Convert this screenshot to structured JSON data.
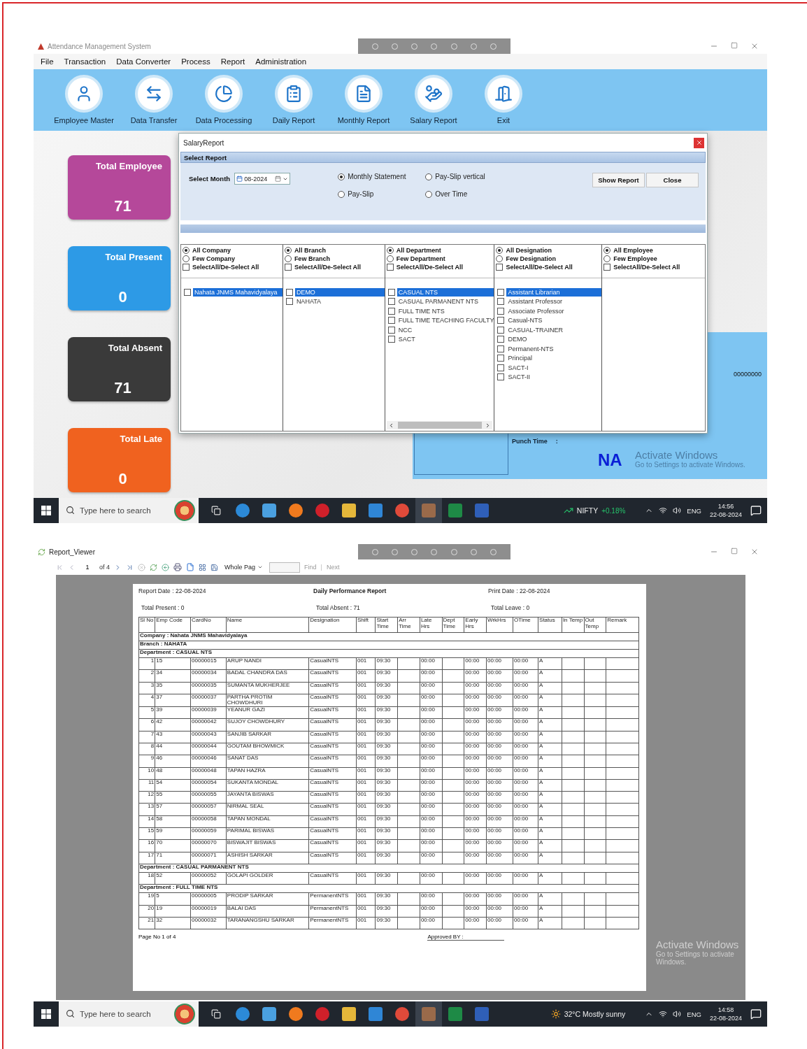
{
  "app_window": {
    "title": "Attendance Management System",
    "menu": [
      "File",
      "Transaction",
      "Data Converter",
      "Process",
      "Report",
      "Administration"
    ],
    "toolbar": [
      "Employee Master",
      "Data Transfer",
      "Data Processing",
      "Daily Report",
      "Monthly Report",
      "Salary Report",
      "Exit"
    ],
    "stat_cards": [
      {
        "label": "Total Employee",
        "value": "71",
        "color": "#b5489a"
      },
      {
        "label": "Total Present",
        "value": "0",
        "color": "#2d9ae6"
      },
      {
        "label": "Total Absent",
        "value": "71",
        "color": "#3a3a3a"
      },
      {
        "label": "Total Late",
        "value": "0",
        "color": "#f0621f"
      }
    ],
    "info_panel": {
      "card_no": "00000000",
      "punch_label": "Punch Time",
      "punch_separator": ":",
      "punch_value": "NA"
    },
    "activation_notice": {
      "title": "Activate Windows",
      "hint": "Go to Settings to activate Windows."
    },
    "dialog": {
      "title": "SalaryReport",
      "section_title": "Select Report",
      "month_label": "Select Month",
      "month_value": "08-2024",
      "report_types": [
        {
          "label": "Monthly Statement",
          "selected": true
        },
        {
          "label": "Pay-Slip vertical",
          "selected": false
        },
        {
          "label": "Pay-Slip",
          "selected": false
        },
        {
          "label": "Over Time",
          "selected": false
        }
      ],
      "buttons": [
        "Show Report",
        "Close"
      ],
      "filters": [
        {
          "options": [
            {
              "label": "All Company",
              "selected": true
            },
            {
              "label": "Few Company",
              "selected": false
            }
          ],
          "select_all": {
            "label": "SelectAll/De-Select All",
            "checked": false
          },
          "items": [
            {
              "label": "Nahata JNMS Mahavidyalaya",
              "checked": false,
              "selected": true
            }
          ]
        },
        {
          "options": [
            {
              "label": "All Branch",
              "selected": true
            },
            {
              "label": "Few Branch",
              "selected": false
            }
          ],
          "select_all": {
            "label": "SelectAll/De-Select All",
            "checked": false
          },
          "items": [
            {
              "label": "DEMO",
              "checked": false,
              "selected": true
            },
            {
              "label": "NAHATA",
              "checked": false,
              "selected": false
            }
          ]
        },
        {
          "options": [
            {
              "label": "All Department",
              "selected": true
            },
            {
              "label": "Few Department",
              "selected": false
            }
          ],
          "select_all": {
            "label": "SelectAll/De-Select All",
            "checked": false
          },
          "horizontal_scrollbar": true,
          "items": [
            {
              "label": "CASUAL NTS",
              "checked": false,
              "selected": true
            },
            {
              "label": "CASUAL PARMANENT NTS",
              "checked": false,
              "selected": false
            },
            {
              "label": "FULL TIME NTS",
              "checked": false,
              "selected": false
            },
            {
              "label": "FULL TIME TEACHING FACULTY",
              "checked": false,
              "selected": false
            },
            {
              "label": "NCC",
              "checked": false,
              "selected": false
            },
            {
              "label": "SACT",
              "checked": false,
              "selected": false
            }
          ]
        },
        {
          "options": [
            {
              "label": "All Designation",
              "selected": true
            },
            {
              "label": "Few Designation",
              "selected": false
            }
          ],
          "select_all": {
            "label": "SelectAll/De-Select All",
            "checked": false
          },
          "items": [
            {
              "label": "Assistant Librarian",
              "checked": false,
              "selected": true
            },
            {
              "label": "Assistant Professor",
              "checked": false,
              "selected": false
            },
            {
              "label": "Associate Professor",
              "checked": false,
              "selected": false
            },
            {
              "label": "Casual-NTS",
              "checked": false,
              "selected": false
            },
            {
              "label": "CASUAL-TRAINER",
              "checked": false,
              "selected": false
            },
            {
              "label": "DEMO",
              "checked": false,
              "selected": false
            },
            {
              "label": "Permanent-NTS",
              "checked": false,
              "selected": false
            },
            {
              "label": "Principal",
              "checked": false,
              "selected": false
            },
            {
              "label": "SACT-I",
              "checked": false,
              "selected": false
            },
            {
              "label": "SACT-II",
              "checked": false,
              "selected": false
            }
          ]
        },
        {
          "options": [
            {
              "label": "All Employee",
              "selected": true
            },
            {
              "label": "Few Employee",
              "selected": false
            }
          ],
          "select_all": {
            "label": "SelectAll/De-Select All",
            "checked": false
          }
        }
      ]
    },
    "taskbar": {
      "search_placeholder": "Type here to search",
      "widget": {
        "kind": "stock",
        "label": "NIFTY",
        "change": "+0.18%"
      },
      "language": "ENG",
      "time": "14:56",
      "date": "22-08-2024"
    }
  },
  "report_window": {
    "title": "Report_Viewer",
    "toolbar": {
      "page": "1",
      "page_count": "of 4",
      "zoom": "Whole Pag",
      "find_label": "Find",
      "separator": "|",
      "next_label": "Next"
    },
    "report": {
      "report_date": "Report Date : 22-08-2024",
      "title": "Daily Performance Report",
      "print_date": "Print Date : 22-08-2024",
      "totals": [
        "Total Present : 0",
        "Total Absent : 71",
        "Total Leave : 0"
      ],
      "columns": [
        "Sl No",
        "Emp Code",
        "CardNo",
        "Name",
        "Designation",
        "Shift",
        "Start Time",
        "Arr Time",
        "Late Hrs",
        "Dept Time",
        "Early Hrs",
        "WrkHrs",
        "OTime",
        "Status",
        "In Temp",
        "Out Temp",
        "Remark"
      ],
      "rows": [
        {
          "kind": "group",
          "text": "Company : Nahata JNMS Mahavidyalaya"
        },
        {
          "kind": "group",
          "text": "Branch : NAHATA"
        },
        {
          "kind": "group",
          "text": "Department : CASUAL NTS"
        },
        {
          "kind": "employee",
          "cells": [
            "1",
            "15",
            "00000015",
            "ARUP NANDI",
            "CasualNTS",
            "001",
            "09:30",
            null,
            "00:00",
            null,
            "00:00",
            "00:00",
            "00:00",
            "A",
            null,
            null,
            null
          ]
        },
        {
          "kind": "employee",
          "cells": [
            "2",
            "34",
            "00000034",
            "BADAL CHANDRA DAS",
            "CasualNTS",
            "001",
            "09:30",
            null,
            "00:00",
            null,
            "00:00",
            "00:00",
            "00:00",
            "A",
            null,
            null,
            null
          ]
        },
        {
          "kind": "employee",
          "cells": [
            "3",
            "35",
            "00000035",
            "SUMANTA MUKHERJEE",
            "CasualNTS",
            "001",
            "09:30",
            null,
            "00:00",
            null,
            "00:00",
            "00:00",
            "00:00",
            "A",
            null,
            null,
            null
          ]
        },
        {
          "kind": "employee",
          "cells": [
            "4",
            "37",
            "00000037",
            "PARTHA PROTIM CHOWDHURI",
            "CasualNTS",
            "001",
            "09:30",
            null,
            "00:00",
            null,
            "00:00",
            "00:00",
            "00:00",
            "A",
            null,
            null,
            null
          ]
        },
        {
          "kind": "employee",
          "cells": [
            "5",
            "39",
            "00000039",
            "YEANUR GAZI",
            "CasualNTS",
            "001",
            "09:30",
            null,
            "00:00",
            null,
            "00:00",
            "00:00",
            "00:00",
            "A",
            null,
            null,
            null
          ]
        },
        {
          "kind": "employee",
          "cells": [
            "6",
            "42",
            "00000042",
            "SUJOY CHOWDHURY",
            "CasualNTS",
            "001",
            "09:30",
            null,
            "00:00",
            null,
            "00:00",
            "00:00",
            "00:00",
            "A",
            null,
            null,
            null
          ]
        },
        {
          "kind": "employee",
          "cells": [
            "7",
            "43",
            "00000043",
            "SANJIB SARKAR",
            "CasualNTS",
            "001",
            "09:30",
            null,
            "00:00",
            null,
            "00:00",
            "00:00",
            "00:00",
            "A",
            null,
            null,
            null
          ]
        },
        {
          "kind": "employee",
          "cells": [
            "8",
            "44",
            "00000044",
            "GOUTAM BHOWMICK",
            "CasualNTS",
            "001",
            "09:30",
            null,
            "00:00",
            null,
            "00:00",
            "00:00",
            "00:00",
            "A",
            null,
            null,
            null
          ]
        },
        {
          "kind": "employee",
          "cells": [
            "9",
            "46",
            "00000046",
            "SANAT DAS",
            "CasualNTS",
            "001",
            "09:30",
            null,
            "00:00",
            null,
            "00:00",
            "00:00",
            "00:00",
            "A",
            null,
            null,
            null
          ]
        },
        {
          "kind": "employee",
          "cells": [
            "10",
            "48",
            "00000048",
            "TAPAN HAZRA",
            "CasualNTS",
            "001",
            "09:30",
            null,
            "00:00",
            null,
            "00:00",
            "00:00",
            "00:00",
            "A",
            null,
            null,
            null
          ]
        },
        {
          "kind": "employee",
          "cells": [
            "11",
            "54",
            "00000054",
            "SUKANTA MONDAL",
            "CasualNTS",
            "001",
            "09:30",
            null,
            "00:00",
            null,
            "00:00",
            "00:00",
            "00:00",
            "A",
            null,
            null,
            null
          ]
        },
        {
          "kind": "employee",
          "cells": [
            "12",
            "55",
            "00000055",
            "JAYANTA BISWAS",
            "CasualNTS",
            "001",
            "09:30",
            null,
            "00:00",
            null,
            "00:00",
            "00:00",
            "00:00",
            "A",
            null,
            null,
            null
          ]
        },
        {
          "kind": "employee",
          "cells": [
            "13",
            "57",
            "00000057",
            "NIRMAL SEAL",
            "CasualNTS",
            "001",
            "09:30",
            null,
            "00:00",
            null,
            "00:00",
            "00:00",
            "00:00",
            "A",
            null,
            null,
            null
          ]
        },
        {
          "kind": "employee",
          "cells": [
            "14",
            "58",
            "00000058",
            "TAPAN MONDAL",
            "CasualNTS",
            "001",
            "09:30",
            null,
            "00:00",
            null,
            "00:00",
            "00:00",
            "00:00",
            "A",
            null,
            null,
            null
          ]
        },
        {
          "kind": "employee",
          "cells": [
            "15",
            "59",
            "00000059",
            "PARIMAL BISWAS",
            "CasualNTS",
            "001",
            "09:30",
            null,
            "00:00",
            null,
            "00:00",
            "00:00",
            "00:00",
            "A",
            null,
            null,
            null
          ]
        },
        {
          "kind": "employee",
          "cells": [
            "16",
            "70",
            "00000070",
            "BISWAJIT BISWAS",
            "CasualNTS",
            "001",
            "09:30",
            null,
            "00:00",
            null,
            "00:00",
            "00:00",
            "00:00",
            "A",
            null,
            null,
            null
          ]
        },
        {
          "kind": "employee",
          "cells": [
            "17",
            "71",
            "00000071",
            "ASHISH SARKAR",
            "CasualNTS",
            "001",
            "09:30",
            null,
            "00:00",
            null,
            "00:00",
            "00:00",
            "00:00",
            "A",
            null,
            null,
            null
          ]
        },
        {
          "kind": "group",
          "text": "Department : CASUAL PARMANENT NTS"
        },
        {
          "kind": "employee",
          "cells": [
            "18",
            "52",
            "00000052",
            "GOLAPI GOLDER",
            "CasualNTS",
            "001",
            "09:30",
            null,
            "00:00",
            null,
            "00:00",
            "00:00",
            "00:00",
            "A",
            null,
            null,
            null
          ]
        },
        {
          "kind": "group",
          "text": "Department : FULL TIME NTS"
        },
        {
          "kind": "employee",
          "cells": [
            "19",
            "5",
            "00000005",
            "PRODIP SARKAR",
            "PermanentNTS",
            "001",
            "09:30",
            null,
            "00:00",
            null,
            "00:00",
            "00:00",
            "00:00",
            "A",
            null,
            null,
            null
          ]
        },
        {
          "kind": "employee",
          "cells": [
            "20",
            "19",
            "00000019",
            "BALAI DAS",
            "PermanentNTS",
            "001",
            "09:30",
            null,
            "00:00",
            null,
            "00:00",
            "00:00",
            "00:00",
            "A",
            null,
            null,
            null
          ]
        },
        {
          "kind": "employee",
          "cells": [
            "21",
            "32",
            "00000032",
            "TARANANGSHU SARKAR",
            "PermanentNTS",
            "001",
            "09:30",
            null,
            "00:00",
            null,
            "00:00",
            "00:00",
            "00:00",
            "A",
            null,
            null,
            null
          ]
        }
      ],
      "page_number": "Page No 1 of 4",
      "approved_by": "Approved BY :"
    },
    "activation_notice": {
      "title": "Activate Windows",
      "hint": "Go to Settings to activate Windows."
    },
    "taskbar": {
      "search_placeholder": "Type here to search",
      "widget": {
        "kind": "weather",
        "temperature": "32°C",
        "condition": "Mostly sunny"
      },
      "language": "ENG",
      "time": "14:58",
      "date": "22-08-2024"
    }
  }
}
